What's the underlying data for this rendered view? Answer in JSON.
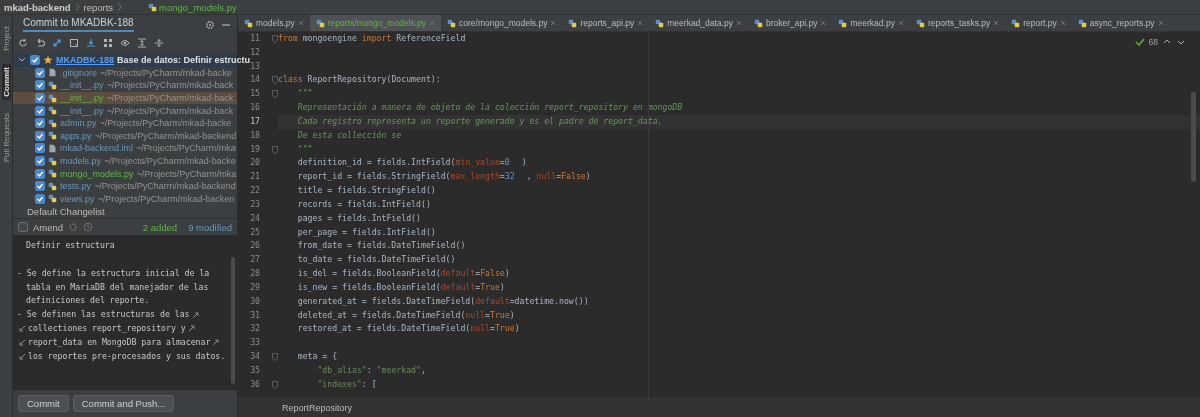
{
  "breadcrumb": [
    {
      "label": "mkad-backend",
      "kind": "project"
    },
    {
      "label": "reports",
      "kind": "folder"
    },
    {
      "label": "mongo_models.py",
      "kind": "file"
    }
  ],
  "tool_stripe": [
    {
      "label": "Project",
      "selected": false
    },
    {
      "label": "Commit",
      "selected": true
    },
    {
      "label": "Pull Requests",
      "selected": false
    }
  ],
  "commit_panel": {
    "title": "Commit to MKADBK-188",
    "changelist": {
      "expanded": true,
      "checked": true,
      "issue": "MKADBK-188",
      "summary": "Base de datos: Definir estructu",
      "files": [
        {
          "name": ".gitignore",
          "path": "~/Projects/PyCharm/mkad-backe",
          "added": false,
          "checked": true,
          "selected": false,
          "kind": "text"
        },
        {
          "name": "__init__.py",
          "path": "~/Projects/PyCharm/mkad-back",
          "added": false,
          "checked": true,
          "selected": false,
          "kind": "python"
        },
        {
          "name": "__init__.py",
          "path": "~/Projects/PyCharm/mkad-back",
          "added": true,
          "checked": true,
          "selected": true,
          "kind": "python"
        },
        {
          "name": "__init__.py",
          "path": "~/Projects/PyCharm/mkad-back",
          "added": false,
          "checked": true,
          "selected": false,
          "kind": "python"
        },
        {
          "name": "admin.py",
          "path": "~/Projects/PyCharm/mkad-backe",
          "added": false,
          "checked": true,
          "selected": false,
          "kind": "python"
        },
        {
          "name": "apps.py",
          "path": "~/Projects/PyCharm/mkad-backend",
          "added": false,
          "checked": true,
          "selected": false,
          "kind": "python"
        },
        {
          "name": "mkad-backend.iml",
          "path": "~/Projects/PyCharm/mka",
          "added": false,
          "checked": true,
          "selected": false,
          "kind": "text"
        },
        {
          "name": "models.py",
          "path": "~/Projects/PyCharm/mkad-backe",
          "added": false,
          "checked": true,
          "selected": false,
          "kind": "python"
        },
        {
          "name": "mongo_models.py",
          "path": "~/Projects/PyCharm/mka",
          "added": true,
          "checked": true,
          "selected": false,
          "kind": "python"
        },
        {
          "name": "tests.py",
          "path": "~/Projects/PyCharm/mkad-backend",
          "added": false,
          "checked": true,
          "selected": false,
          "kind": "python"
        },
        {
          "name": "views.py",
          "path": "~/Projects/PyCharm/mkad-backen",
          "added": false,
          "checked": true,
          "selected": false,
          "kind": "python"
        }
      ]
    },
    "default_changelist": "Default Changelist",
    "amend": {
      "label": "Amend",
      "checked": false
    },
    "added": "2 added",
    "modified": "9 modified",
    "message": [
      {
        "lines": [
          {
            "text": "Definir estructura",
            "indent": true,
            "wrap_start": false,
            "wrap_end": false
          }
        ]
      },
      {
        "lines": [
          {
            "text": "- Se define la estructura inicial de la",
            "indent": false,
            "wrap_start": false,
            "wrap_end": false
          },
          {
            "text": "tabla en MariaDB del manejador de las",
            "indent": true,
            "wrap_start": false,
            "wrap_end": false
          },
          {
            "text": "definiciones del reporte.",
            "indent": true,
            "wrap_start": false,
            "wrap_end": false
          },
          {
            "text": "- Se definen las estructuras de las",
            "indent": false,
            "wrap_start": false,
            "wrap_end": true
          },
          {
            "text": "collectiones report_repository y",
            "indent": false,
            "wrap_start": true,
            "wrap_end": true
          },
          {
            "text": "report_data en MongoDB para almacenar",
            "indent": false,
            "wrap_start": true,
            "wrap_end": true
          },
          {
            "text": "los reportes pre-procesados y sus datos.",
            "indent": false,
            "wrap_start": true,
            "wrap_end": false
          }
        ]
      }
    ],
    "buttons": [
      "Commit",
      "Commit and Push..."
    ]
  },
  "tabs": [
    {
      "label": "models.py",
      "selected": false,
      "added": false
    },
    {
      "label": "reports/mongo_models.py",
      "selected": true,
      "added": true
    },
    {
      "label": "core/mongo_models.py",
      "selected": false,
      "added": false
    },
    {
      "label": "reports_api.py",
      "selected": false,
      "added": false
    },
    {
      "label": "meerkad_data.py",
      "selected": false,
      "added": false
    },
    {
      "label": "broker_api.py",
      "selected": false,
      "added": false
    },
    {
      "label": "meerkad.py",
      "selected": false,
      "added": false
    },
    {
      "label": "reports_tasks.py",
      "selected": false,
      "added": false
    },
    {
      "label": "report.py",
      "selected": false,
      "added": false
    },
    {
      "label": "async_reports.py",
      "selected": false,
      "added": false
    }
  ],
  "inspections": "68",
  "code": [
    {
      "n": "11",
      "fold": true,
      "current": false,
      "tokens": [
        {
          "kind": "kw",
          "text": "from"
        },
        {
          "kind": "p",
          "text": " mongoengine "
        },
        {
          "kind": "kw",
          "text": "import"
        },
        {
          "kind": "p",
          "text": " ReferenceField"
        }
      ]
    },
    {
      "n": "12",
      "fold": false,
      "current": false
    },
    {
      "n": "13",
      "fold": false,
      "current": false
    },
    {
      "n": "14",
      "fold": true,
      "current": false,
      "tokens": [
        {
          "kind": "kw",
          "text": "class"
        },
        {
          "kind": "p",
          "text": " ReportRepository(Document):"
        }
      ]
    },
    {
      "n": "15",
      "fold": true,
      "current": false,
      "tokens": [
        {
          "kind": "doc",
          "text": "    \"\"\""
        }
      ]
    },
    {
      "n": "16",
      "fold": false,
      "current": false,
      "tokens": [
        {
          "kind": "doc",
          "text": "    Representación a manera de objeto de la colección report_repository en mongoDB"
        }
      ]
    },
    {
      "n": "17",
      "fold": false,
      "current": true,
      "tokens": [
        {
          "kind": "doc",
          "text": "    Cada registro representa un reporte generado y es el padre de report_data."
        }
      ]
    },
    {
      "n": "18",
      "fold": false,
      "current": false,
      "tokens": [
        {
          "kind": "doc",
          "text": "    De esta collección se"
        }
      ]
    },
    {
      "n": "19",
      "fold": true,
      "current": false,
      "tokens": [
        {
          "kind": "doc",
          "text": "    \"\"\""
        }
      ]
    },
    {
      "n": "20",
      "fold": false,
      "current": false,
      "tokens": [
        {
          "kind": "p",
          "text": "    definition_id = fields.IntField("
        },
        {
          "kind": "param",
          "text": "min_value"
        },
        {
          "kind": "p",
          "text": "="
        },
        {
          "kind": "num",
          "text": "0"
        },
        {
          "kind": "p",
          "text": ")"
        }
      ]
    },
    {
      "n": "21",
      "fold": false,
      "current": false,
      "tokens": [
        {
          "kind": "p",
          "text": "    report_id = fields.StringField("
        },
        {
          "kind": "param",
          "text": "max_length"
        },
        {
          "kind": "p",
          "text": "="
        },
        {
          "kind": "num",
          "text": "32"
        },
        {
          "kind": "p",
          "text": ", "
        },
        {
          "kind": "param",
          "text": "null"
        },
        {
          "kind": "p",
          "text": "="
        },
        {
          "kind": "kw",
          "text": "False"
        },
        {
          "kind": "p",
          "text": ")"
        }
      ]
    },
    {
      "n": "22",
      "fold": false,
      "current": false,
      "tokens": [
        {
          "kind": "p",
          "text": "    title = fields.StringField()"
        }
      ]
    },
    {
      "n": "23",
      "fold": false,
      "current": false,
      "tokens": [
        {
          "kind": "p",
          "text": "    records = fields.IntField()"
        }
      ]
    },
    {
      "n": "24",
      "fold": false,
      "current": false,
      "tokens": [
        {
          "kind": "p",
          "text": "    pages = fields.IntField()"
        }
      ]
    },
    {
      "n": "25",
      "fold": false,
      "current": false,
      "tokens": [
        {
          "kind": "p",
          "text": "    per_page = fields.IntField()"
        }
      ]
    },
    {
      "n": "26",
      "fold": false,
      "current": false,
      "tokens": [
        {
          "kind": "p",
          "text": "    from_date = fields.DateTimeField()"
        }
      ]
    },
    {
      "n": "27",
      "fold": false,
      "current": false,
      "tokens": [
        {
          "kind": "p",
          "text": "    to_date = fields.DateTimeField()"
        }
      ]
    },
    {
      "n": "28",
      "fold": false,
      "current": false,
      "tokens": [
        {
          "kind": "p",
          "text": "    is_del = fields.BooleanField("
        },
        {
          "kind": "param",
          "text": "default"
        },
        {
          "kind": "p",
          "text": "="
        },
        {
          "kind": "kw",
          "text": "False"
        },
        {
          "kind": "p",
          "text": ")"
        }
      ]
    },
    {
      "n": "29",
      "fold": false,
      "current": false,
      "tokens": [
        {
          "kind": "p",
          "text": "    is_new = fields.BooleanField("
        },
        {
          "kind": "param",
          "text": "default"
        },
        {
          "kind": "p",
          "text": "="
        },
        {
          "kind": "kw",
          "text": "True"
        },
        {
          "kind": "p",
          "text": ")"
        }
      ]
    },
    {
      "n": "30",
      "fold": false,
      "current": false,
      "tokens": [
        {
          "kind": "p",
          "text": "    generated_at = fields.DateTimeField("
        },
        {
          "kind": "param",
          "text": "default"
        },
        {
          "kind": "p",
          "text": "=datetime.now())"
        }
      ]
    },
    {
      "n": "31",
      "fold": false,
      "current": false,
      "tokens": [
        {
          "kind": "p",
          "text": "    deleted_at = fields.DateTimeField("
        },
        {
          "kind": "param",
          "text": "null"
        },
        {
          "kind": "p",
          "text": "="
        },
        {
          "kind": "kw",
          "text": "True"
        },
        {
          "kind": "p",
          "text": ")"
        }
      ]
    },
    {
      "n": "32",
      "fold": false,
      "current": false,
      "tokens": [
        {
          "kind": "p",
          "text": "    restored_at = fields.DateTimeField("
        },
        {
          "kind": "param",
          "text": "null"
        },
        {
          "kind": "p",
          "text": "="
        },
        {
          "kind": "kw",
          "text": "True"
        },
        {
          "kind": "p",
          "text": ")"
        }
      ]
    },
    {
      "n": "33",
      "fold": false,
      "current": false
    },
    {
      "n": "34",
      "fold": true,
      "current": false,
      "tokens": [
        {
          "kind": "p",
          "text": "    meta = {"
        }
      ]
    },
    {
      "n": "35",
      "fold": false,
      "current": false,
      "tokens": [
        {
          "kind": "str",
          "text": "        \"db_alias\""
        },
        {
          "kind": "p",
          "text": ": "
        },
        {
          "kind": "str",
          "text": "\"meerkad\""
        },
        {
          "kind": "p",
          "text": ","
        }
      ]
    },
    {
      "n": "36",
      "fold": true,
      "current": false,
      "tokens": [
        {
          "kind": "str",
          "text": "        \"indexes\""
        },
        {
          "kind": "p",
          "text": ": ["
        }
      ]
    }
  ],
  "editor_breadcrumb": "ReportRepository"
}
